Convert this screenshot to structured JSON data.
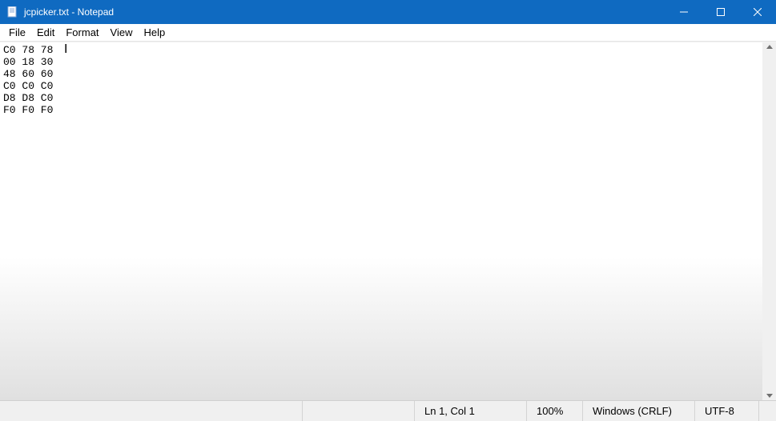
{
  "window": {
    "title": "jcpicker.txt - Notepad"
  },
  "menu": {
    "file": "File",
    "edit": "Edit",
    "format": "Format",
    "view": "View",
    "help": "Help"
  },
  "editor": {
    "content": "C0 78 78\n00 18 30\n48 60 60\nC0 C0 C0\nD8 D8 C0\nF0 F0 F0"
  },
  "status": {
    "position": "Ln 1, Col 1",
    "zoom": "100%",
    "lineending": "Windows (CRLF)",
    "encoding": "UTF-8"
  }
}
